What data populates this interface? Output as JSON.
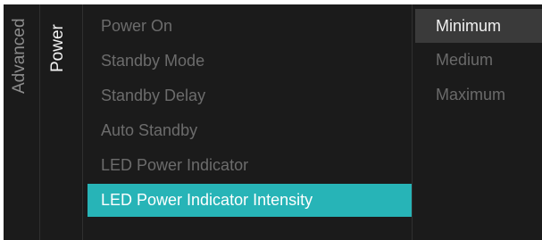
{
  "breadcrumb": {
    "parent": "Advanced",
    "current": "Power"
  },
  "menu": {
    "items": [
      {
        "label": "Power On"
      },
      {
        "label": "Standby Mode"
      },
      {
        "label": "Standby Delay"
      },
      {
        "label": "Auto Standby"
      },
      {
        "label": "LED Power Indicator"
      },
      {
        "label": "LED Power Indicator Intensity",
        "selected": true
      }
    ]
  },
  "options": {
    "items": [
      {
        "label": "Minimum",
        "focused": true
      },
      {
        "label": "Medium"
      },
      {
        "label": "Maximum"
      }
    ]
  },
  "colors": {
    "background": "#1b1b1b",
    "highlight": "#27b4b7",
    "focus": "#3a3a3a"
  }
}
